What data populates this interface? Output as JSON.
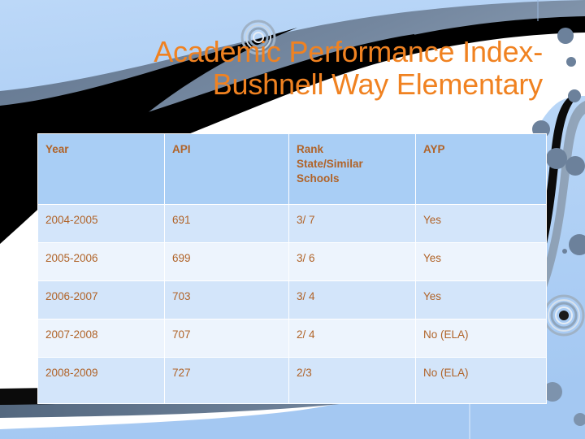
{
  "slide": {
    "title_lines": [
      "Academic Performance Index-",
      "Bushnell Way Elementary"
    ],
    "title_color": "#F08221",
    "accent_text_color": "#B06328",
    "header_bg": "#A9CEF5",
    "row_bg_a": "#D3E5FA",
    "row_bg_b": "#EDF4FD",
    "backdrop_blue": "#AFD0F5",
    "backdrop_slate": "#6C819B",
    "backdrop_black": "#000000"
  },
  "table": {
    "columns": [
      "Year",
      "API",
      "Rank State/Similar Schools",
      "AYP"
    ],
    "header_display": [
      "Year",
      "API",
      "Rank\nState/Similar\nSchools",
      "AYP"
    ],
    "rows": [
      {
        "year": "2004-2005",
        "api": "691",
        "rank": "3/ 7",
        "ayp": "Yes"
      },
      {
        "year": "2005-2006",
        "api": "699",
        "rank": "3/ 6",
        "ayp": "Yes"
      },
      {
        "year": "2006-2007",
        "api": "703",
        "rank": "3/ 4",
        "ayp": "Yes"
      },
      {
        "year": "2007-2008",
        "api": "707",
        "rank": "2/ 4",
        "ayp": "No (ELA)"
      },
      {
        "year": "2008-2009",
        "api": "727",
        "rank": "2/3",
        "ayp": "No (ELA)"
      }
    ]
  },
  "decor": {
    "ring_top_name": "concentric-ring-icon",
    "ring_bottom_name": "concentric-ring-icon",
    "dot_count": 9
  }
}
